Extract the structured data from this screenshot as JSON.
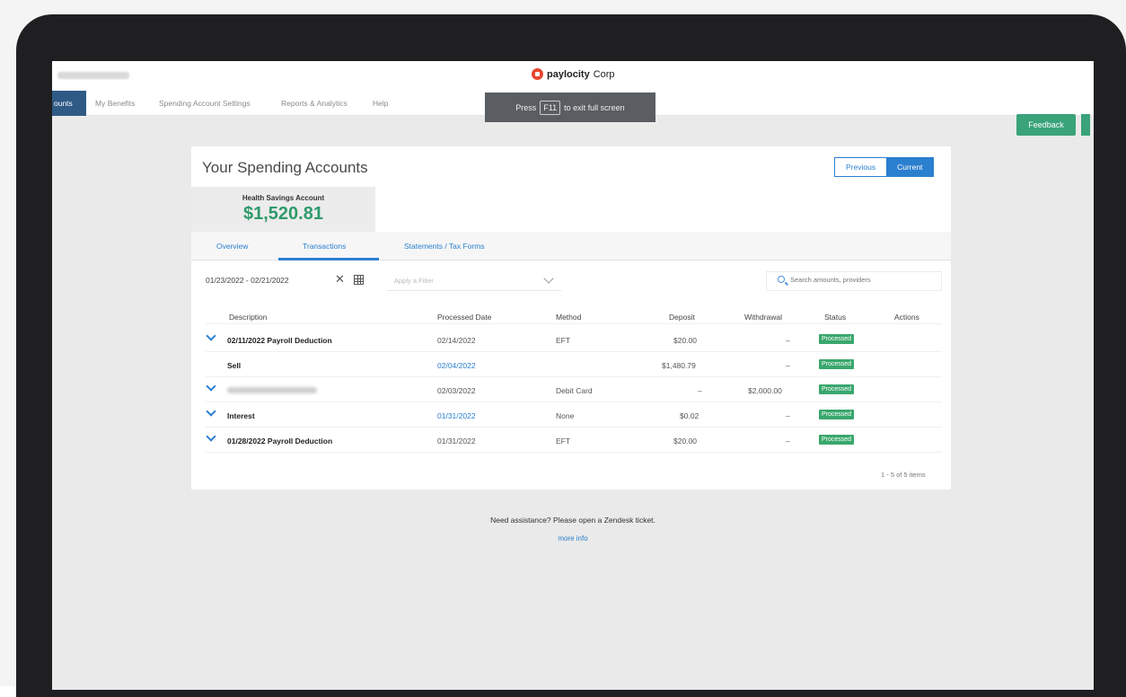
{
  "topbar": {
    "brand_name": "paylocity",
    "brand_suffix": "Corp"
  },
  "nav": {
    "active": "ounts",
    "items": [
      "My Benefits",
      "Spending Account Settings",
      "Reports & Analytics",
      "Help"
    ]
  },
  "fullscreen_hint": {
    "press": "Press",
    "key": "F11",
    "rest": "to exit full screen"
  },
  "feedback_label": "Feedback",
  "page_title": "Your Spending Accounts",
  "period": {
    "previous": "Previous",
    "current": "Current"
  },
  "account": {
    "name": "Health Savings Account",
    "balance": "$1,520.81"
  },
  "tabs": [
    "Overview",
    "Transactions",
    "Statements / Tax Forms"
  ],
  "filters": {
    "date_range": "01/23/2022 - 02/21/2022",
    "filter_placeholder": "Apply a Filter",
    "search_placeholder": "Search amounts, providers"
  },
  "table": {
    "headers": [
      "Description",
      "Processed Date",
      "Method",
      "Deposit",
      "Withdrawal",
      "Status",
      "Actions"
    ],
    "rows": [
      {
        "description": "02/11/2022 Payroll Deduction",
        "date": "02/14/2022",
        "method": "EFT",
        "deposit": "$20.00",
        "withdrawal": "–",
        "status": "Processed"
      },
      {
        "description": "Sell",
        "date": "02/04/2022",
        "method": "",
        "deposit": "$1,480.79",
        "withdrawal": "–",
        "status": "Processed"
      },
      {
        "description": "",
        "date": "02/03/2022",
        "method": "Debit Card",
        "deposit": "–",
        "withdrawal": "$2,000.00",
        "status": "Processed"
      },
      {
        "description": "Interest",
        "date": "01/31/2022",
        "method": "None",
        "deposit": "$0.02",
        "withdrawal": "–",
        "status": "Processed"
      },
      {
        "description": "01/28/2022 Payroll Deduction",
        "date": "01/31/2022",
        "method": "EFT",
        "deposit": "$20.00",
        "withdrawal": "–",
        "status": "Processed"
      }
    ],
    "pager": "1 - 5 of 5 items"
  },
  "footer": {
    "help_text": "Need assistance? Please open a Zendesk ticket.",
    "more_info": "more info"
  }
}
